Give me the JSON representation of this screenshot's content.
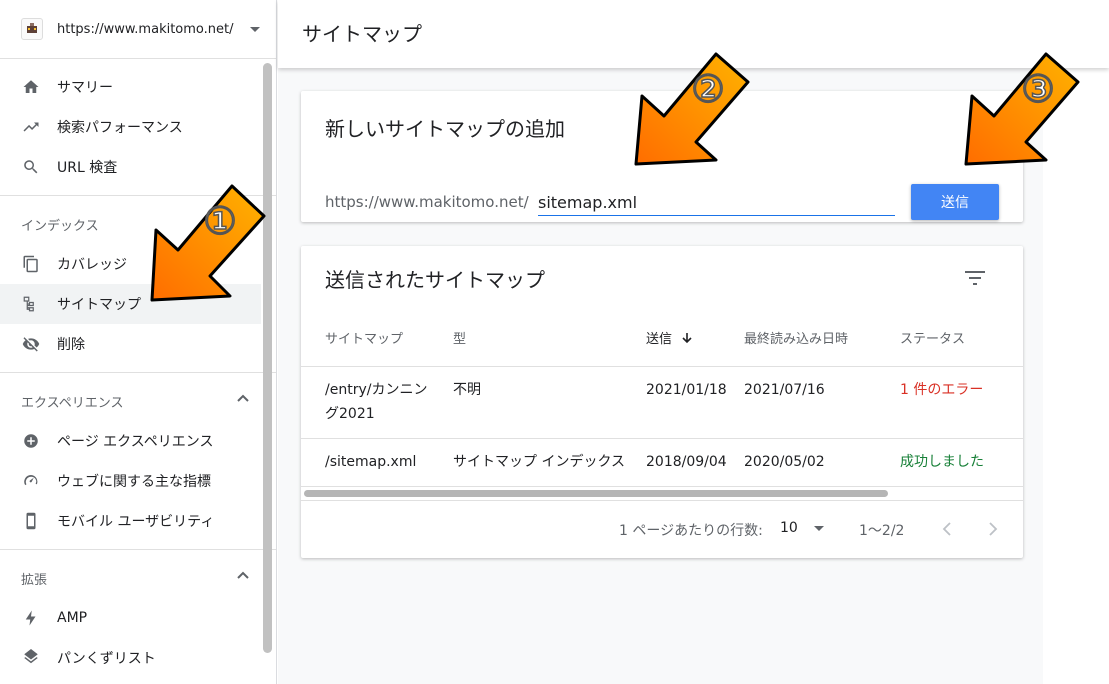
{
  "property": {
    "url": "https://www.makitomo.net/"
  },
  "nav": {
    "top_items": [
      {
        "label": "サマリー",
        "icon": "home-icon"
      },
      {
        "label": "検索パフォーマンス",
        "icon": "trending-up-icon"
      },
      {
        "label": "URL 検査",
        "icon": "search-icon"
      }
    ],
    "index_group": "インデックス",
    "index_items": [
      {
        "label": "カバレッジ",
        "icon": "copy-icon"
      },
      {
        "label": "サイトマップ",
        "icon": "sitemap-icon"
      },
      {
        "label": "削除",
        "icon": "visibility-off-icon"
      }
    ],
    "experience_group": "エクスペリエンス",
    "experience_items": [
      {
        "label": "ページ エクスペリエンス",
        "icon": "plus-circle-icon"
      },
      {
        "label": "ウェブに関する主な指標",
        "icon": "speed-icon"
      },
      {
        "label": "モバイル ユーザビリティ",
        "icon": "phone-icon"
      }
    ],
    "enhancement_group": "拡張",
    "enhancement_items": [
      {
        "label": "AMP",
        "icon": "bolt-icon"
      },
      {
        "label": "パンくずリスト",
        "icon": "layers-icon"
      }
    ]
  },
  "page": {
    "title": "サイトマップ"
  },
  "add_card": {
    "title": "新しいサイトマップの追加",
    "prefix": "https://www.makitomo.net/",
    "input_value": "sitemap.xml",
    "submit_label": "送信"
  },
  "list_card": {
    "title": "送信されたサイトマップ",
    "columns": [
      "サイトマップ",
      "型",
      "送信",
      "最終読み込み日時",
      "ステータス"
    ],
    "rows": [
      {
        "sitemap_line1": "/entry/カンニン",
        "sitemap_line2": "グ2021",
        "type": "不明",
        "submitted": "2021/01/18",
        "last_read": "2021/07/16",
        "status": "1 件のエラー"
      },
      {
        "sitemap_line1": "/sitemap.xml",
        "type": "サイトマップ インデックス",
        "submitted": "2018/09/04",
        "last_read": "2020/05/02",
        "status": "成功しました"
      }
    ],
    "pagination": {
      "rows_per_page_label": "1 ページあたりの行数:",
      "rows_per_page": "10",
      "range": "1〜2/2"
    }
  },
  "annotations": {
    "arrow1": "①",
    "arrow2": "②",
    "arrow3": "③"
  },
  "colors": {
    "accent": "#4285f4",
    "error": "#d93025",
    "success": "#188038",
    "arrow": "#f57c00"
  }
}
